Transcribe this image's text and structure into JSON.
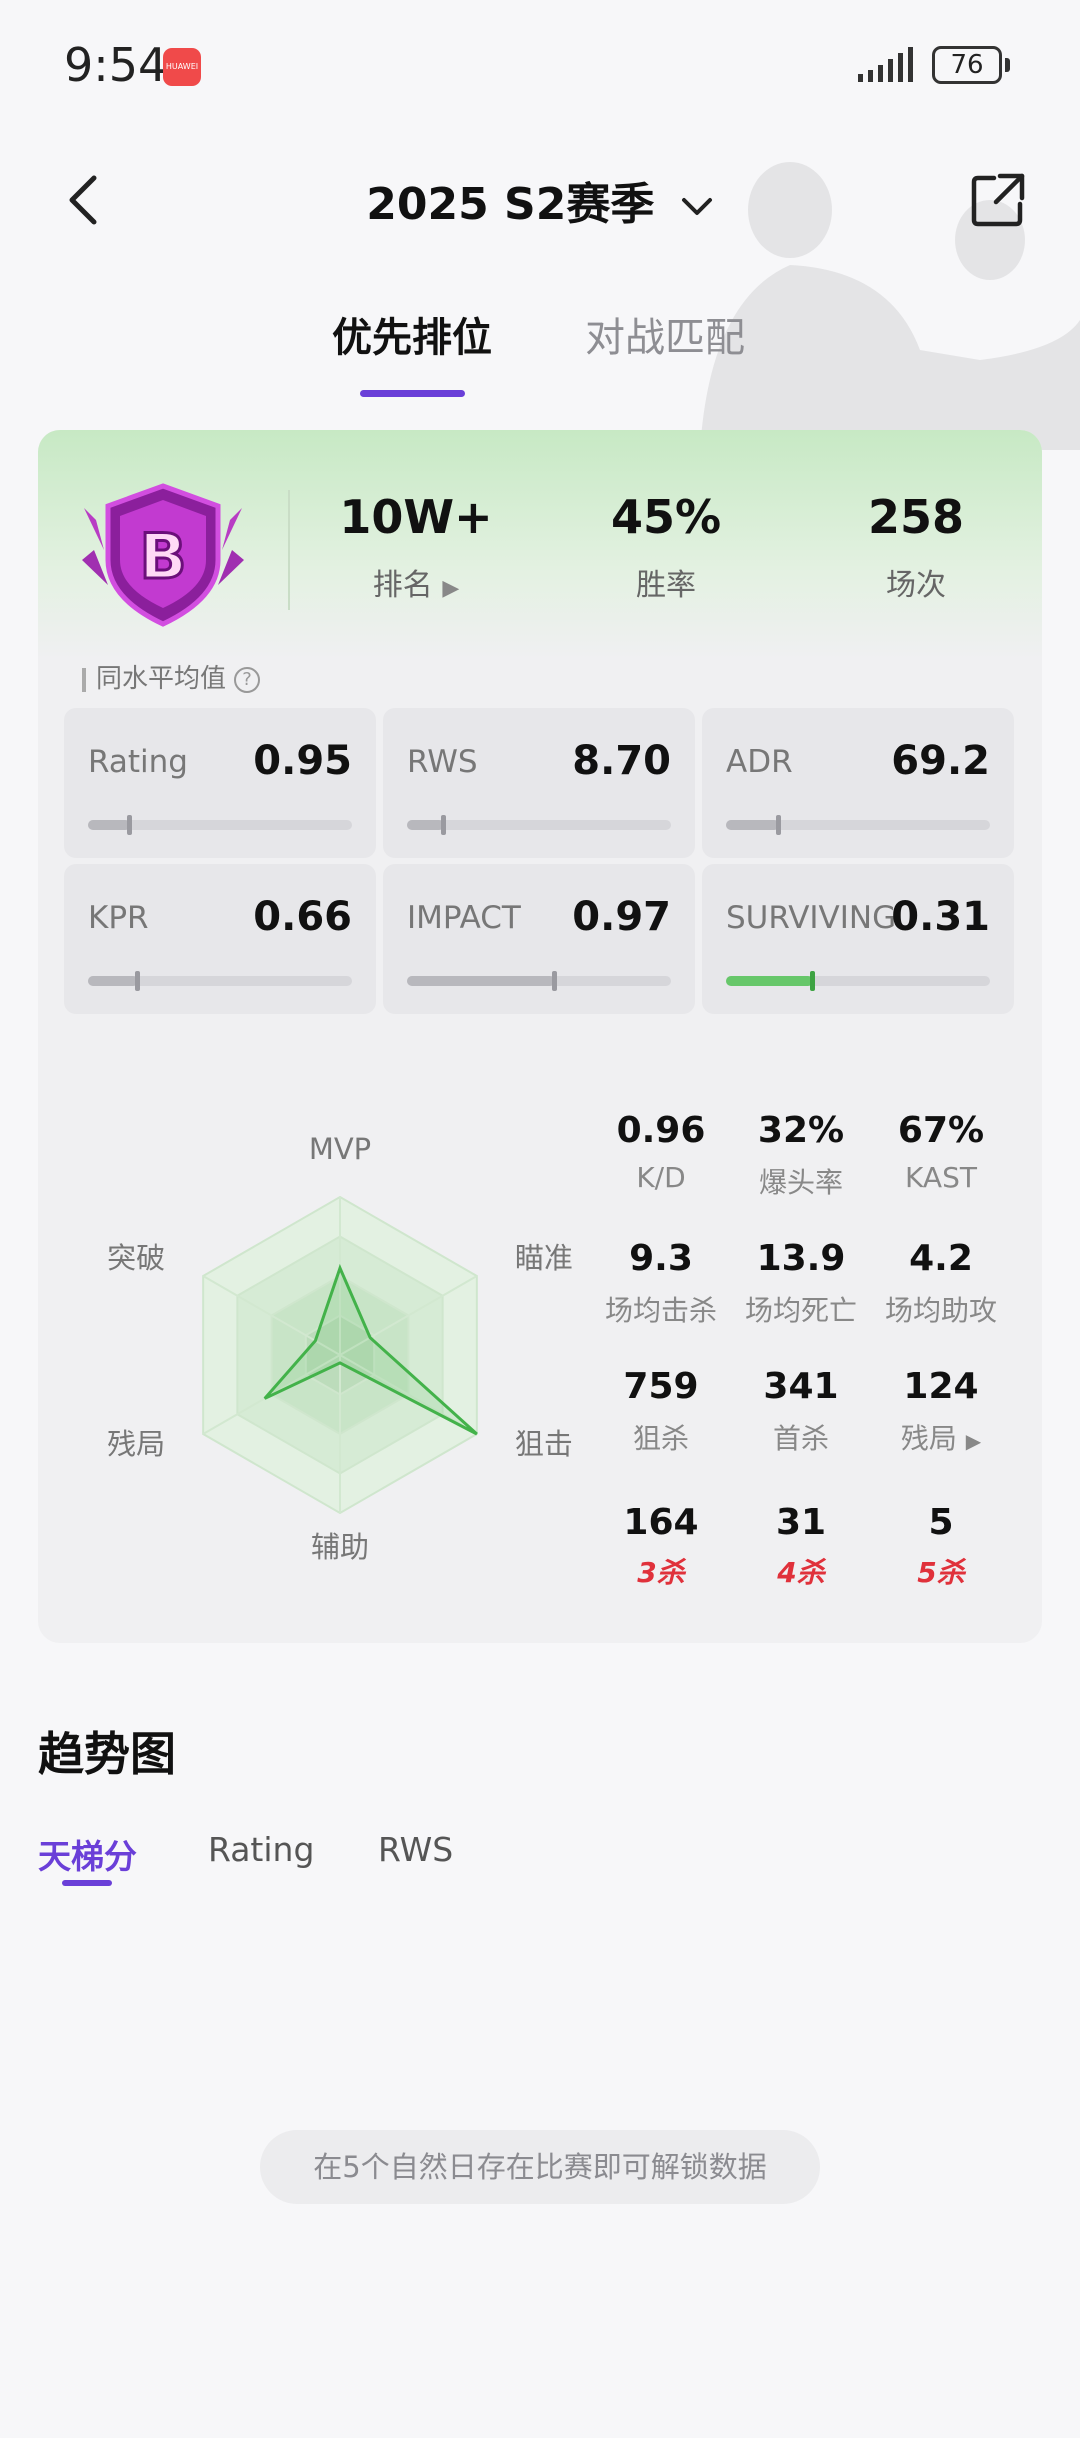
{
  "status": {
    "time": "9:54",
    "app_badge": "HUAWEI",
    "battery": "76"
  },
  "header": {
    "title": "2025 S2赛季"
  },
  "tabs": [
    {
      "label": "优先排位"
    },
    {
      "label": "对战匹配"
    }
  ],
  "summary": {
    "rank": {
      "value": "10W+",
      "label": "排名"
    },
    "winrate": {
      "value": "45%",
      "label": "胜率"
    },
    "games": {
      "value": "258",
      "label": "场次"
    },
    "badge_letter": "B"
  },
  "avg_label": "同水平均值",
  "metrics": [
    {
      "label": "Rating",
      "value": "0.95",
      "fill": 0.16
    },
    {
      "label": "RWS",
      "value": "8.70",
      "fill": 0.14
    },
    {
      "label": "ADR",
      "value": "69.2",
      "fill": 0.2
    },
    {
      "label": "KPR",
      "value": "0.66",
      "fill": 0.19
    },
    {
      "label": "IMPACT",
      "value": "0.97",
      "fill": 0.56
    },
    {
      "label": "SURVIVING",
      "value": "0.31",
      "fill": 0.33,
      "color": "#67c76a"
    }
  ],
  "radar": {
    "axes": [
      "MVP",
      "瞄准",
      "狙击",
      "辅助",
      "残局",
      "突破"
    ],
    "values": [
      0.55,
      0.22,
      1.0,
      0.05,
      0.55,
      0.18
    ],
    "line_color": "#43b24a"
  },
  "stats_grid": [
    {
      "value": "0.96",
      "label": "K/D"
    },
    {
      "value": "32%",
      "label": "爆头率"
    },
    {
      "value": "67%",
      "label": "KAST"
    },
    {
      "value": "9.3",
      "label": "场均击杀"
    },
    {
      "value": "13.9",
      "label": "场均死亡"
    },
    {
      "value": "4.2",
      "label": "场均助攻"
    },
    {
      "value": "759",
      "label": "狙杀"
    },
    {
      "value": "341",
      "label": "首杀"
    },
    {
      "value": "124",
      "label": "残局"
    },
    {
      "value": "164",
      "tag": "3杀"
    },
    {
      "value": "31",
      "tag": "4杀"
    },
    {
      "value": "5",
      "tag": "5杀"
    }
  ],
  "trend": {
    "title": "趋势图",
    "tabs": [
      "天梯分",
      "Rating",
      "RWS"
    ],
    "empty_message": "在5个自然日存在比赛即可解锁数据"
  },
  "colors": {
    "accent": "#6a3fd8",
    "kill_red": "#e0313b",
    "green": "#43b24a"
  }
}
